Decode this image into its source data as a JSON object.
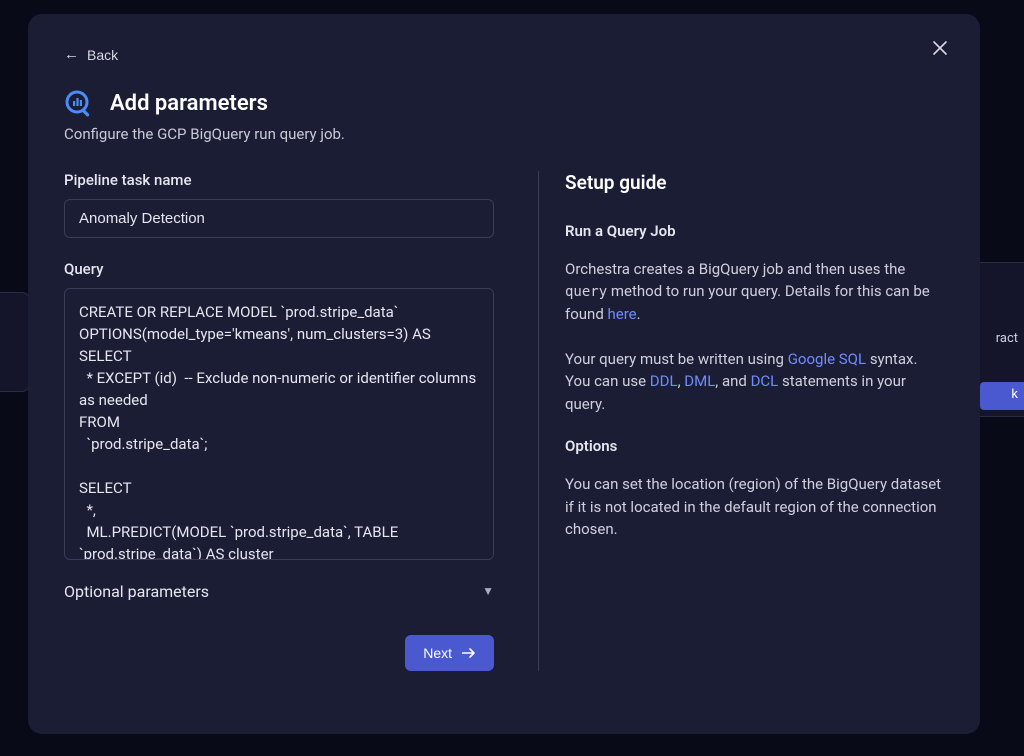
{
  "back_label": "Back",
  "title": "Add parameters",
  "subtitle": "Configure the GCP BigQuery run query job.",
  "left": {
    "task_name_label": "Pipeline task name",
    "task_name_value": "Anomaly Detection",
    "query_label": "Query",
    "query_value": "CREATE OR REPLACE MODEL `prod.stripe_data`\nOPTIONS(model_type='kmeans', num_clusters=3) AS\nSELECT\n  * EXCEPT (id)  -- Exclude non-numeric or identifier columns as needed\nFROM\n  `prod.stripe_data`;\n\nSELECT\n  *,\n  ML.PREDICT(MODEL `prod.stripe_data`, TABLE `prod.stripe_data`) AS cluster\nFROM\n  `prod.stripe_data`;",
    "optional_label": "Optional parameters",
    "next_label": "Next"
  },
  "right": {
    "guide_title": "Setup guide",
    "run_query_heading": "Run a Query Job",
    "p1_a": "Orchestra creates a BigQuery job and then uses the ",
    "p1_code": "query",
    "p1_b": " method to run your query. Details for this can be found ",
    "p1_link": "here",
    "p1_c": ".",
    "p2_a": "Your query must be written using ",
    "p2_link1": "Google SQL",
    "p2_b": " syntax. You can use ",
    "p2_link2": "DDL",
    "p2_sep1": ", ",
    "p2_link3": "DML",
    "p2_sep2": ", and ",
    "p2_link4": "DCL",
    "p2_c": " statements in your query.",
    "options_heading": "Options",
    "p3": "You can set the location (region) of the BigQuery dataset if it is not located in the default region of the connection chosen."
  },
  "bg": {
    "ract": "ract",
    "k": "k"
  }
}
